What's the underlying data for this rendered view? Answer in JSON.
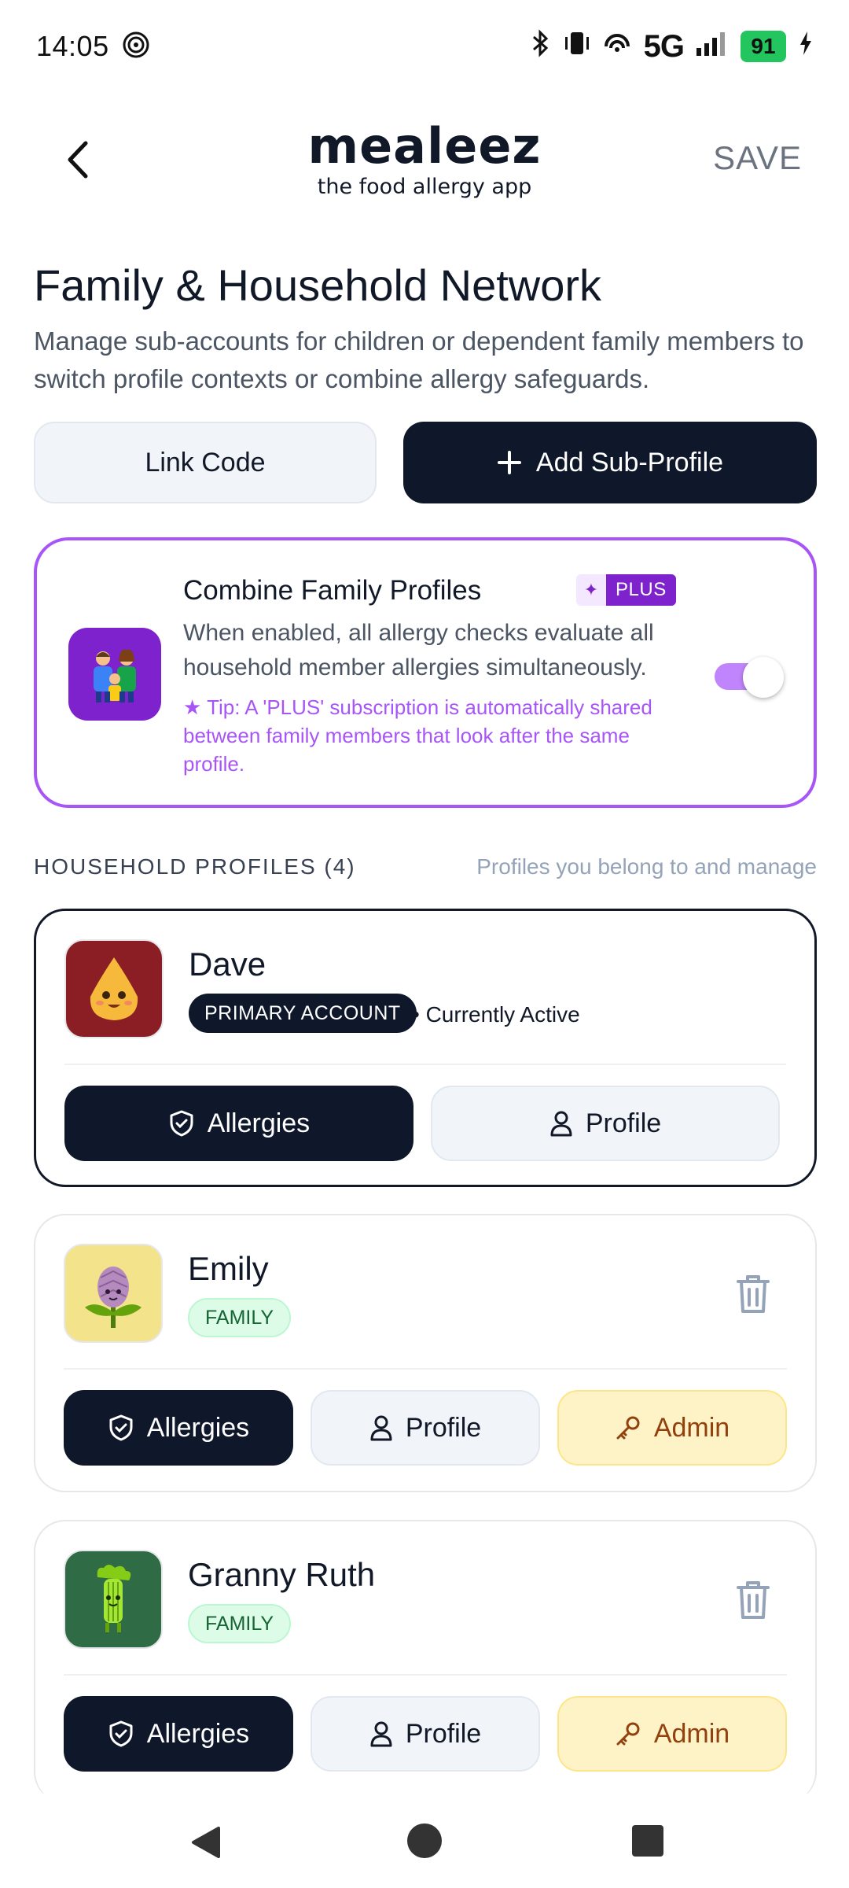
{
  "status_bar": {
    "time": "14:05",
    "network": "5G",
    "battery": "91"
  },
  "app_bar": {
    "logo_name": "mealeez",
    "logo_tagline": "the food allergy app",
    "save_label": "SAVE"
  },
  "header": {
    "title": "Family & Household Network",
    "description": "Manage sub-accounts for children or dependent family members to switch profile contexts or combine allergy safeguards."
  },
  "actions": {
    "link_code": "Link Code",
    "add_sub_profile": "Add Sub-Profile"
  },
  "combine": {
    "title": "Combine Family Profiles",
    "badge": "PLUS",
    "description": "When enabled, all allergy checks evaluate all household member allergies simultaneously.",
    "tip": "★ Tip: A 'PLUS' subscription is automatically shared between family members that look after the same profile.",
    "enabled": true
  },
  "section": {
    "title": "HOUSEHOLD PROFILES (4)",
    "subtitle": "Profiles you belong to and manage"
  },
  "profiles": [
    {
      "name": "Dave",
      "badge": "PRIMARY ACCOUNT",
      "status": "• Currently Active",
      "allergies": "Allergies",
      "profile": "Profile"
    },
    {
      "name": "Emily",
      "badge": "FAMILY",
      "allergies": "Allergies",
      "profile": "Profile",
      "admin": "Admin"
    },
    {
      "name": "Granny Ruth",
      "badge": "FAMILY",
      "allergies": "Allergies",
      "profile": "Profile",
      "admin": "Admin"
    }
  ],
  "colors": {
    "dark": "#0f172a",
    "accent_purple": "#a855f7",
    "family_green": "#dcfce7",
    "admin_yellow": "#fef3c7"
  }
}
